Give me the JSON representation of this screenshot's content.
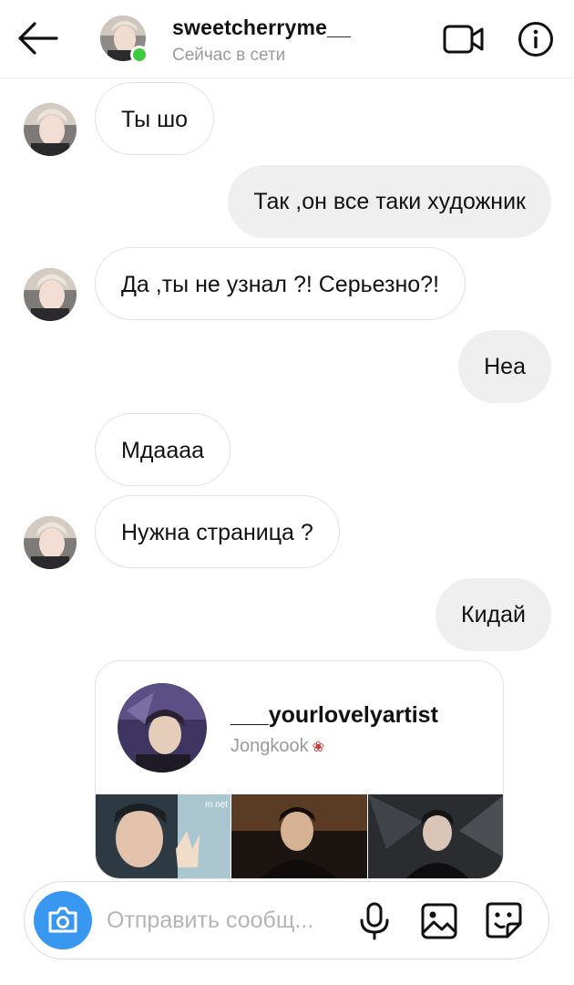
{
  "header": {
    "username": "sweetcherryme__",
    "status": "Сейчас в сети",
    "icons": {
      "back": "arrow-left-icon",
      "video": "video-camera-icon",
      "info": "info-icon"
    },
    "online_color": "#3ec93e"
  },
  "messages": [
    {
      "side": "in",
      "text": "Ты шо"
    },
    {
      "side": "out",
      "text": "Так ,он все таки художник"
    },
    {
      "side": "in",
      "text": "Да ,ты не узнал ?! Серьезно?!"
    },
    {
      "side": "out",
      "text": "Неа"
    },
    {
      "side": "in",
      "text": "Мдаааа"
    },
    {
      "side": "in",
      "text": "Нужна страница ?"
    },
    {
      "side": "out",
      "text": "Кидай"
    }
  ],
  "shared_profile": {
    "username": "___yourlovelyartist",
    "name": "Jongkook",
    "name_emoji": "rose-icon",
    "thumb_watermark": "m net"
  },
  "composer": {
    "placeholder": "Отправить сообщ...",
    "value": "",
    "icons": {
      "camera": "camera-icon",
      "mic": "microphone-icon",
      "gallery": "image-icon",
      "sticker": "sticker-icon"
    },
    "accent": "#3897f0"
  }
}
